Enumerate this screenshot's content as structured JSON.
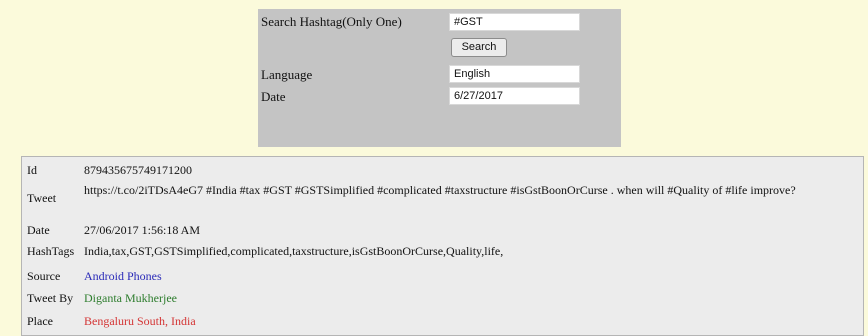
{
  "search_form": {
    "hashtag_label": "Search Hashtag(Only One)",
    "hashtag_value": "#GST",
    "search_button": "Search",
    "language_label": "Language",
    "language_value": "English",
    "date_label": "Date",
    "date_value": "6/27/2017"
  },
  "tweet": {
    "id_label": "Id",
    "id_value": "879435675749171200",
    "tweet_label": "Tweet",
    "tweet_value": "https://t.co/2iTDsA4eG7 #India #tax #GST #GSTSimplified #complicated #taxstructure #isGstBoonOrCurse . when will #Quality of #life improve?",
    "date_label": "Date",
    "date_value": "27/06/2017 1:56:18 AM",
    "hashtags_label": "HashTags",
    "hashtags_value": "India,tax,GST,GSTSimplified,complicated,taxstructure,isGstBoonOrCurse,Quality,life,",
    "source_label": "Source",
    "source_value": "Android Phones",
    "tweet_by_label": "Tweet By",
    "tweet_by_value": "Diganta Mukherjee",
    "place_label": "Place",
    "place_value": "Bengaluru South, India"
  },
  "colors": {
    "page_bg": "#fbfadb",
    "panel_bg": "#c4c4c4",
    "results_bg": "#ececec",
    "source_color": "#2a2ab8",
    "tweet_by_color": "#2e7d2e",
    "place_color": "#d43535"
  }
}
